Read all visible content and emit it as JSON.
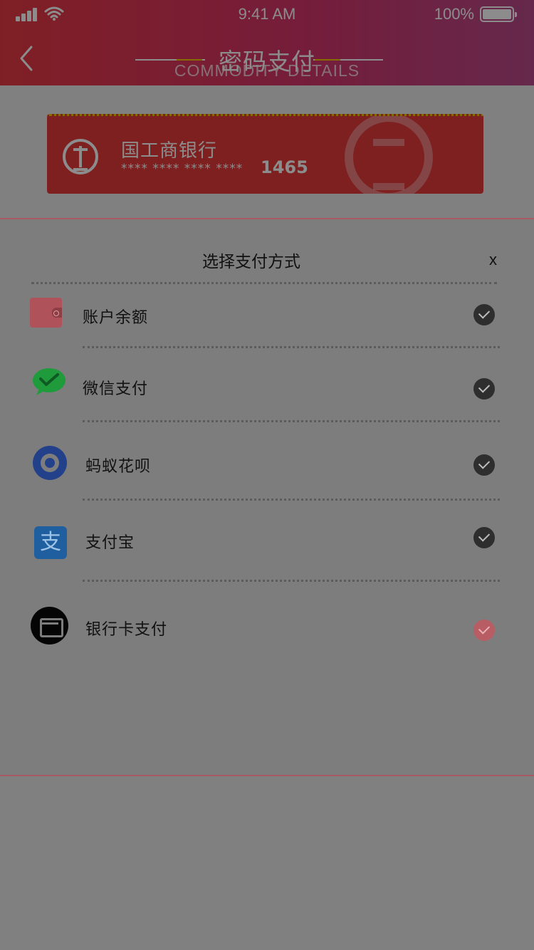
{
  "status_bar": {
    "time": "9:41 AM",
    "battery": "100%",
    "signal_icon": "cellular-signal-icon",
    "wifi_icon": "wifi-icon",
    "battery_icon": "battery-icon"
  },
  "header": {
    "title": "密码支付",
    "subtitle": "COMMODITY DETAILS",
    "back_icon": "chevron-left-icon",
    "gradient_colors": [
      "#e83a44",
      "#d6356a",
      "#b94a8a"
    ],
    "accent_color": "#f5c400"
  },
  "bank_card": {
    "bank_name": "国工商银行",
    "masked_number": "**** **** **** ****",
    "last_digits": "1465",
    "background_color": "#e53b3b"
  },
  "payment_sheet": {
    "title": "选择支付方式",
    "close_label": "x",
    "methods": [
      {
        "label": "账户余额",
        "icon": "wallet-icon",
        "selected": false
      },
      {
        "label": "微信支付",
        "icon": "wechat-icon",
        "selected": false
      },
      {
        "label": "蚂蚁花呗",
        "icon": "huabei-icon",
        "selected": false
      },
      {
        "label": "支付宝",
        "icon": "alipay-icon",
        "selected": false
      },
      {
        "label": "银行卡支付",
        "icon": "bankcard-icon",
        "selected": true
      }
    ]
  },
  "alipay_glyph": "支"
}
